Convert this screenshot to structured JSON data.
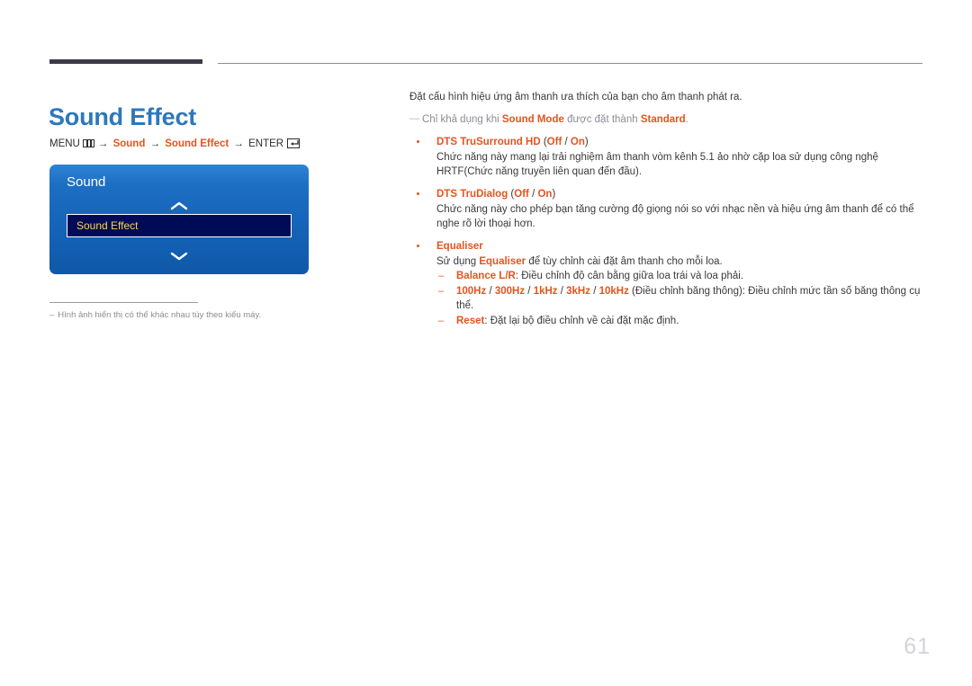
{
  "page": {
    "title": "Sound Effect",
    "number": "61",
    "accent_blue": "#2e77bc",
    "accent_orange": "#e3541f",
    "rule_dark": "#3c3b48",
    "rule_light": "#8b8b93"
  },
  "menu_path": {
    "menu_label": "MENU",
    "menu_icon": "menu-grid-icon",
    "arrow": "→",
    "step1": "Sound",
    "step2": "Sound Effect",
    "enter_label": "ENTER",
    "enter_icon": "enter-return-icon"
  },
  "osd": {
    "title": "Sound",
    "chevron_up_icon": "chevron-up-icon",
    "chevron_down_icon": "chevron-down-icon",
    "selected_item": "Sound Effect",
    "selected_text_color": "#ffd24a",
    "selected_bg_color": "#000b58",
    "panel_color": "#1464b9"
  },
  "left_note": {
    "dash": "–",
    "text": "Hình ảnh hiển thị có thể khác nhau tùy theo kiểu máy."
  },
  "content": {
    "intro": "Đặt cấu hình hiệu ứng âm thanh ưa thích của bạn cho âm thanh phát ra.",
    "note": {
      "emdash": "—",
      "part1": "Chỉ khả dụng khi ",
      "kw1": "Sound Mode",
      "part2": " được đặt thành ",
      "kw2": "Standard",
      "part3": "."
    },
    "bullets": [
      {
        "name": "DTS TruSurround HD",
        "opt_open": " (",
        "opt_off": "Off",
        "opt_sep": " / ",
        "opt_on": "On",
        "opt_close": ")",
        "body": "Chức năng này mang lại trải nghiệm âm thanh vòm kênh 5.1 ảo nhờ cặp loa sử dụng công nghệ HRTF(Chức năng truyền liên quan đến đầu)."
      },
      {
        "name": "DTS TruDialog",
        "opt_open": " (",
        "opt_off": "Off",
        "opt_sep": " / ",
        "opt_on": "On",
        "opt_close": ")",
        "body": "Chức năng này cho phép bạn tăng cường độ giọng nói so với nhạc nền và hiệu ứng âm thanh để có thể nghe rõ lời thoại hơn."
      }
    ],
    "equaliser": {
      "name": "Equaliser",
      "body_part1": "Sử dụng ",
      "body_kw": "Equaliser",
      "body_part2": " để tùy chỉnh cài đặt âm thanh cho mỗi loa.",
      "sub_items": [
        {
          "dash": "–",
          "label": "Balance L/R",
          "text": ": Điều chỉnh độ cân bằng giữa loa trái và loa phải."
        },
        {
          "dash": "–",
          "freqs": [
            "100Hz",
            "300Hz",
            "1kHz",
            "3kHz",
            "10kHz"
          ],
          "freq_sep": " / ",
          "text": " (Điều chỉnh băng thông): Điều chỉnh mức tần số băng thông cụ thể."
        },
        {
          "dash": "–",
          "label": "Reset",
          "text": ": Đặt lại bộ điều chỉnh về cài đặt mặc định."
        }
      ]
    }
  }
}
